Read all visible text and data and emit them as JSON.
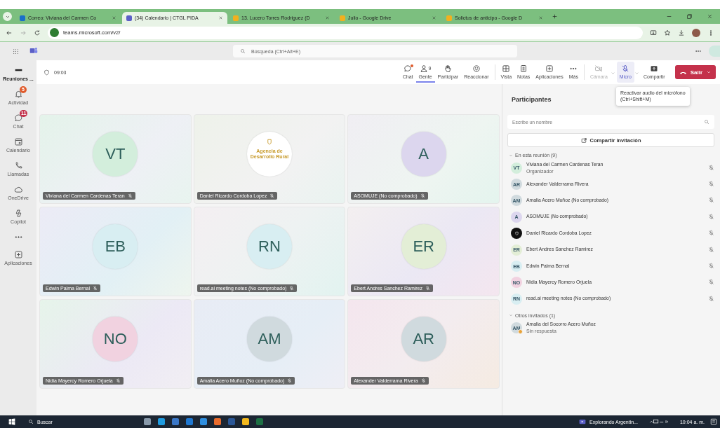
{
  "browser": {
    "tabs": [
      {
        "title": "Correo: Viviana del Carmen Co",
        "selected": false,
        "color": "#1a6fc9"
      },
      {
        "title": "(34) Calendario | CTGL PIDA",
        "selected": true,
        "color": "#5b5fc7"
      },
      {
        "title": "13. Lucero Torres Rodriguez (D",
        "selected": false,
        "color": "#f2b01e"
      },
      {
        "title": "Julio - Google Drive",
        "selected": false,
        "color": "#f2b01e"
      },
      {
        "title": "Solictus de anticipo - Google D",
        "selected": false,
        "color": "#f2b01e"
      }
    ],
    "url": "teams.microsoft.com/v2/"
  },
  "header": {
    "search_placeholder": "Búsqueda (Ctrl+Alt+E)"
  },
  "rail": [
    {
      "label": "Reuniones ...",
      "selected": true
    },
    {
      "label": "Actividad",
      "badge": "5",
      "selected": false
    },
    {
      "label": "Chat",
      "badge": "11",
      "selected": false
    },
    {
      "label": "Calendario",
      "selected": false
    },
    {
      "label": "Llamadas",
      "selected": false
    },
    {
      "label": "OneDrive",
      "selected": false
    },
    {
      "label": "Copilot",
      "selected": false
    },
    {
      "selected": false
    },
    {
      "label": "Aplicaciones",
      "selected": false
    }
  ],
  "meeting": {
    "timer": "09:03",
    "toolbar": [
      {
        "label": "Chat",
        "selected": false,
        "disabled": false,
        "dot": true
      },
      {
        "label": "Gente",
        "count": "9",
        "selected": true,
        "disabled": false,
        "dot": false
      },
      {
        "label": "Participar",
        "selected": false,
        "disabled": false,
        "dot": false
      },
      {
        "label": "Reaccionar",
        "selected": false,
        "disabled": false,
        "dot": false
      },
      {
        "label": "Vista",
        "selected": false,
        "disabled": false,
        "dot": false
      },
      {
        "label": "Notas",
        "selected": false,
        "disabled": false,
        "dot": false
      },
      {
        "label": "Aplicaciones",
        "selected": false,
        "disabled": false,
        "dot": false
      },
      {
        "label": "Más",
        "selected": false,
        "disabled": false,
        "dot": false
      },
      {
        "label": "Cámara",
        "selected": false,
        "disabled": true,
        "dot": false
      },
      {
        "label": "Micro",
        "selected": false,
        "disabled": false,
        "dot": false
      },
      {
        "label": "Compartir",
        "selected": false,
        "disabled": false,
        "dot": false
      }
    ],
    "leave": "Salir",
    "tooltip": [
      "Reactivar audio del micrófono",
      "(Ctrl+Shift+M)"
    ]
  },
  "tiles": [
    {
      "kind": "initials",
      "initials": "VT",
      "name": "Viviana del Carmen Cardenas Teran",
      "color": "#d3eedc"
    },
    {
      "kind": "logo",
      "logo_text": "Agencia de Desarrollo Rural",
      "name": "Daniel Ricardo Cordoba Lopez",
      "color": "#ffffff"
    },
    {
      "kind": "initials",
      "initials": "A",
      "name": "ASOMUJE (No comprobado)",
      "color": "#dcd6ee"
    },
    {
      "kind": "initials",
      "initials": "EB",
      "name": "Edwin Palma Bernal",
      "color": "#d8eef2"
    },
    {
      "kind": "initials",
      "initials": "RN",
      "name": "read.ai meeting notes (No comprobado)",
      "color": "#d8eef2"
    },
    {
      "kind": "initials",
      "initials": "ER",
      "name": "Ebert Andres Sanchez Ramirez",
      "color": "#e3eed6"
    },
    {
      "kind": "initials",
      "initials": "NO",
      "name": "Nidia Mayercy Romero Orjuela",
      "color": "#f1d2e0"
    },
    {
      "kind": "initials",
      "initials": "AM",
      "name": "Amalia Acero Muñoz (No comprobado)",
      "color": "#d0dade"
    },
    {
      "kind": "initials",
      "initials": "AR",
      "name": "Alexander Valderrama Rivera",
      "color": "#d0dade"
    }
  ],
  "panel": {
    "title": "Participantes",
    "search_placeholder": "Escribe un nombre",
    "share": "Compartir invitación",
    "sections": [
      {
        "title": "En esta reunión (9)",
        "expanded": true,
        "people": [
          {
            "kind": "initials",
            "initials": "VT",
            "name": "Viviana del Carmen Cardenas Teran",
            "subtitle": "Organizador",
            "color": "#d3eedc",
            "muted": true,
            "pending": false
          },
          {
            "kind": "initials",
            "initials": "AR",
            "name": "Alexander Valderrama Rivera",
            "color": "#d0dade",
            "muted": true,
            "pending": false
          },
          {
            "kind": "initials",
            "initials": "AM",
            "name": "Amalia Acero Muñoz (No comprobado)",
            "color": "#d0dade",
            "muted": true,
            "pending": false
          },
          {
            "kind": "initials",
            "initials": "A",
            "name": "ASOMUJE (No comprobado)",
            "color": "#dcd6ee",
            "muted": true,
            "pending": false
          },
          {
            "kind": "logo",
            "name": "Daniel Ricardo Cordoba Lopez",
            "color": "#111111",
            "muted": true,
            "pending": false
          },
          {
            "kind": "initials",
            "initials": "ER",
            "name": "Ebert Andres Sanchez Ramirez",
            "color": "#e3eed6",
            "muted": true,
            "pending": false
          },
          {
            "kind": "initials",
            "initials": "EB",
            "name": "Edwin Palma Bernal",
            "color": "#d8eef2",
            "muted": true,
            "pending": false
          },
          {
            "kind": "initials",
            "initials": "NO",
            "name": "Nidia Mayercy Romero Orjuela",
            "color": "#f1d2e0",
            "muted": true,
            "pending": false
          },
          {
            "kind": "initials",
            "initials": "RN",
            "name": "read.ai meeting notes (No comprobado)",
            "color": "#d8eef2",
            "muted": true,
            "pending": false
          }
        ]
      },
      {
        "title": "Otros invitados (1)",
        "expanded": true,
        "people": [
          {
            "kind": "initials",
            "initials": "AM",
            "name": "Amalia del Socorro Acero Muñoz",
            "subtitle": "Sin respuesta",
            "color": "#d0dade",
            "muted": false,
            "pending": true
          }
        ]
      }
    ]
  },
  "taskbar": {
    "search": "Buscar",
    "notification": "Explorando Argentin...",
    "time": "10:04 a. m."
  }
}
